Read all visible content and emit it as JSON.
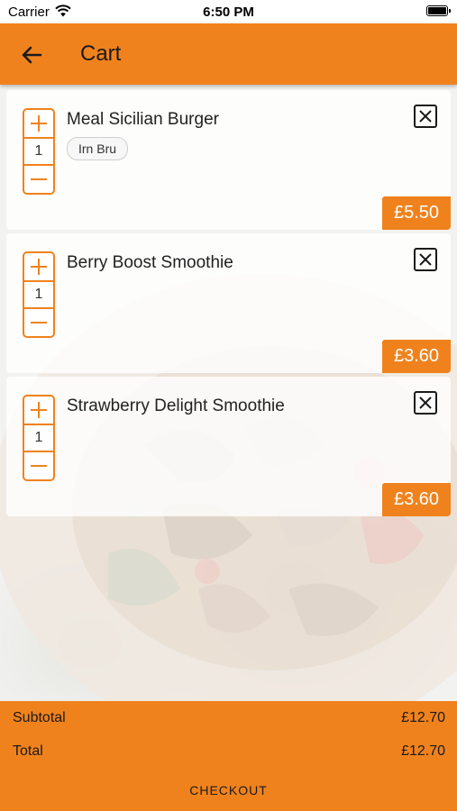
{
  "status_bar": {
    "carrier": "Carrier",
    "time": "6:50 PM"
  },
  "header": {
    "title": "Cart",
    "back_icon": "arrow-left-icon"
  },
  "cart": {
    "items": [
      {
        "name": "Meal Sicilian Burger",
        "quantity": "1",
        "modifier": "Irn Bru",
        "price": "£5.50"
      },
      {
        "name": "Berry Boost Smoothie",
        "quantity": "1",
        "price": "£3.60"
      },
      {
        "name": "Strawberry Delight Smoothie",
        "quantity": "1",
        "price": "£3.60"
      }
    ]
  },
  "summary": {
    "subtotal_label": "Subtotal",
    "subtotal_value": "£12.70",
    "total_label": "Total",
    "total_value": "£12.70",
    "checkout_label": "CHECKOUT"
  },
  "colors": {
    "accent": "#f0821d",
    "text": "#1a1a1a",
    "price_text": "#ffffff"
  }
}
